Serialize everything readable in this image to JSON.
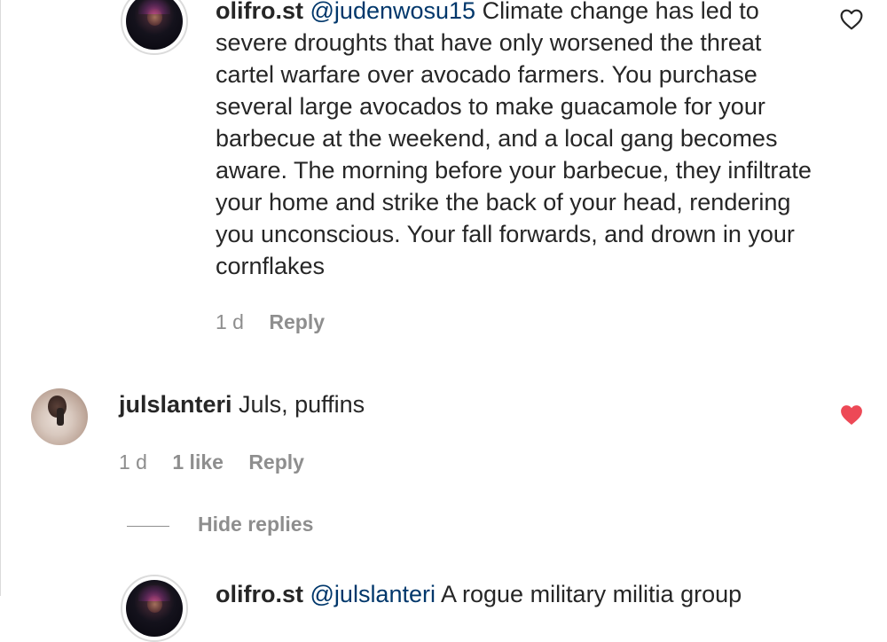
{
  "comments": [
    {
      "username": "olifro.st",
      "mention": "@judenwosu15",
      "text": " Climate change has led to severe droughts that have only worsened the threat cartel warfare over avocado farmers. You purchase several large avocados to make guacamole for your barbecue at the weekend, and a local gang becomes aware. The morning before your barbecue, they infiltrate your home and strike the back of your head, rendering you unconscious. Your fall forwards, and drown in your cornflakes",
      "time": "1 d",
      "reply_label": "Reply",
      "liked": false
    },
    {
      "username": "julslanteri",
      "text": " Juls, puffins",
      "time": "1 d",
      "likes": "1 like",
      "reply_label": "Reply",
      "liked": true
    },
    {
      "username": "olifro.st",
      "mention": "@julslanteri",
      "text": " A rogue military militia group",
      "liked": false
    }
  ],
  "hide_replies_label": "Hide replies",
  "colors": {
    "text": "#262626",
    "muted": "#8e8e8e",
    "mention": "#00376b",
    "like_red": "#ed4956",
    "border": "#dbdbdb"
  }
}
